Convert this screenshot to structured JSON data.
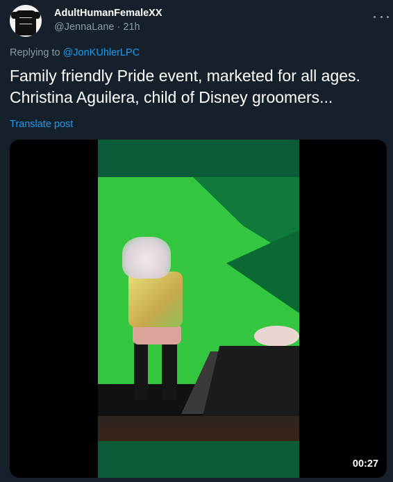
{
  "tweet": {
    "display_name": "AdultHumanFemaleXX",
    "handle": "@JennaLane",
    "separator": "·",
    "time": "21h",
    "replying_prefix": "Replying to",
    "replying_to": "@JonKUhlerLPC",
    "text": "Family friendly Pride event, marketed for all ages. Christina Aguilera, child of Disney groomers...",
    "translate_label": "Translate post"
  },
  "media": {
    "duration": "00:27"
  },
  "colors": {
    "background": "#15202b",
    "accent": "#1d9bf0",
    "secondary_text": "#8b98a5"
  }
}
